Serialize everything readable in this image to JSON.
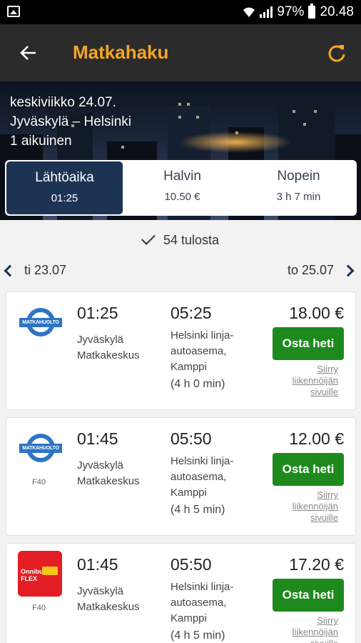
{
  "status_bar": {
    "battery": "97%",
    "time": "20.48"
  },
  "app_bar": {
    "title": "Matkahaku"
  },
  "search": {
    "date": "keskiviikko 24.07.",
    "route": "Jyväskylä – Helsinki",
    "passengers": "1 aikuinen"
  },
  "tabs": [
    {
      "label": "Lähtöaika",
      "value": "01:25",
      "active": true
    },
    {
      "label": "Halvin",
      "value": "10.50 €",
      "active": false
    },
    {
      "label": "Nopein",
      "value": "3 h 7 min",
      "active": false
    }
  ],
  "results_count": "54 tulosta",
  "date_nav": {
    "prev": "ti 23.07",
    "next": "to 25.07"
  },
  "buy_label": "Osta heti",
  "operator_link_label": "Siirry liikennöijän sivuille",
  "results": [
    {
      "logo": "matkahuolto",
      "logo_text": "MATKAHUOLTO",
      "line_code": "",
      "dep_time": "01:25",
      "dep_place": "Jyväskylä Matkakeskus",
      "arr_time": "05:25",
      "arr_place": "Helsinki linja-autoasema, Kamppi",
      "duration": "(4 h 0 min)",
      "price": "18.00 €"
    },
    {
      "logo": "matkahuolto",
      "logo_text": "MATKAHUOLTO",
      "line_code": "F40",
      "dep_time": "01:45",
      "dep_place": "Jyväskylä Matkakeskus",
      "arr_time": "05:50",
      "arr_place": "Helsinki linja-autoasema, Kamppi",
      "duration": "(4 h 5 min)",
      "price": "12.00 €"
    },
    {
      "logo": "onnibus-flex",
      "logo_text": "Onnibus FLEX",
      "line_code": "F40",
      "dep_time": "01:45",
      "dep_place": "Jyväskylä Matkakeskus",
      "arr_time": "05:50",
      "arr_place": "Helsinki linja-autoasema, Kamppi",
      "duration": "(4 h 5 min)",
      "price": "17.20 €"
    }
  ],
  "colors": {
    "accent": "#f5a623",
    "navy": "#1d3354",
    "buy": "#1e8a1e"
  }
}
